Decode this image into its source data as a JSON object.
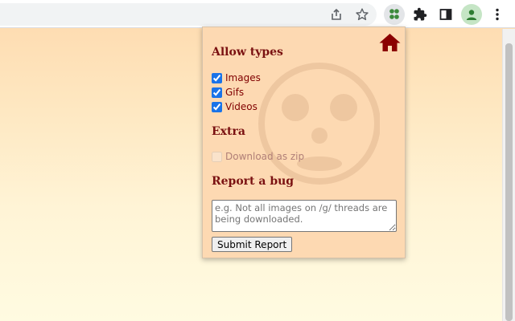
{
  "browser": {
    "toolbar_icons": [
      "share-icon",
      "bookmark-star-icon",
      "extension-app-icon",
      "puzzle-icon",
      "side-panel-icon",
      "profile-avatar-icon",
      "kebab-menu-icon"
    ]
  },
  "popup": {
    "home_icon": "home-icon",
    "allow_types": {
      "title": "Allow types",
      "options": [
        {
          "label": "Images",
          "checked": true
        },
        {
          "label": "Gifs",
          "checked": true
        },
        {
          "label": "Videos",
          "checked": true
        }
      ]
    },
    "extra": {
      "title": "Extra",
      "options": [
        {
          "label": "Download as zip",
          "checked": false,
          "disabled": true
        }
      ]
    },
    "report": {
      "title": "Report a bug",
      "placeholder": "e.g. Not all images on /g/ threads are being downloaded.",
      "submit_label": "Submit Report"
    }
  },
  "colors": {
    "accent": "#7a1111",
    "popup_bg": "#fdd9b2",
    "home_icon": "#8b0000"
  }
}
